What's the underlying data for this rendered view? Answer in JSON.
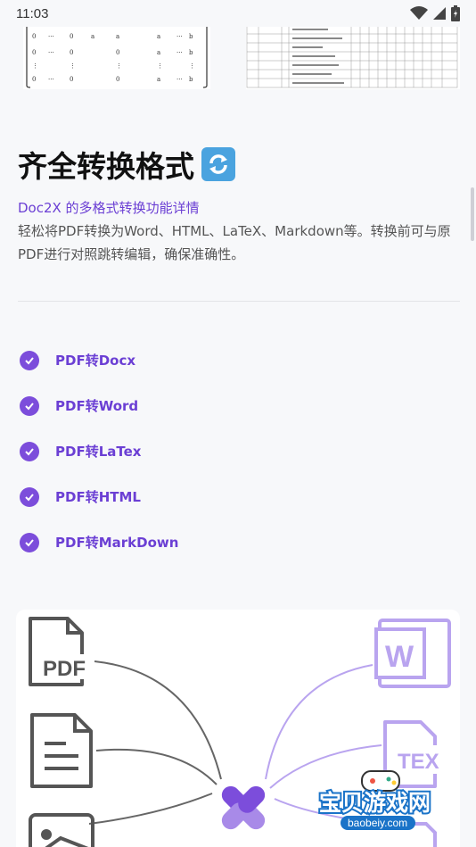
{
  "status_bar": {
    "time": "11:03",
    "icons": [
      "wifi-icon",
      "signal-icon",
      "battery-icon"
    ]
  },
  "section": {
    "title": "齐全转换格式",
    "title_emoji": "arrows-cycle-icon",
    "subtitle": "Doc2X 的多格式转换功能详情",
    "description": "轻松将PDF转换为Word、HTML、LaTeX、Markdown等。转换前可与原PDF进行对照跳转编辑，确保准确性。"
  },
  "features": [
    {
      "label": "PDF转Docx"
    },
    {
      "label": "PDF转Word"
    },
    {
      "label": "PDF转LaTex"
    },
    {
      "label": "PDF转HTML"
    },
    {
      "label": "PDF转MarkDown"
    }
  ],
  "diagram": {
    "left_icons": [
      "pdf-file-icon",
      "document-file-icon",
      "image-file-icon"
    ],
    "pdf_label": "PDF",
    "right_icons": [
      "word-file-icon",
      "tex-file-icon"
    ],
    "word_label": "W",
    "tex_label": "TEX",
    "center_icon": "doc2x-logo-icon"
  },
  "watermark": {
    "title": "宝贝游戏网",
    "url": "baobeiy.com"
  },
  "colors": {
    "accent": "#6b3fd4",
    "check": "#7c4ddb",
    "background": "#f7f8fa"
  }
}
